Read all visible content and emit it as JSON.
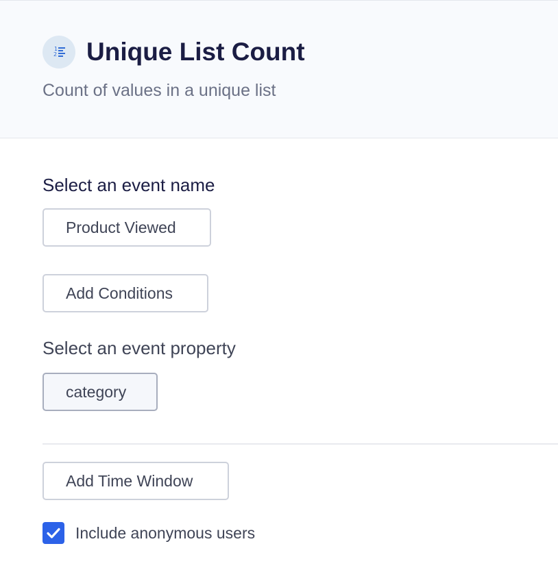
{
  "header": {
    "icon": "numbered-list-icon",
    "title": "Unique List Count",
    "subtitle": "Count of values in a unique list"
  },
  "event_section": {
    "label": "Select an event name",
    "selected_event": "Product Viewed",
    "add_conditions_label": "Add Conditions"
  },
  "property_section": {
    "label": "Select an event property",
    "selected_property": "category"
  },
  "time_window": {
    "label": "Add Time Window"
  },
  "anonymous": {
    "label": "Include anonymous users",
    "checked": true
  },
  "colors": {
    "accent": "#2c62e8",
    "title": "#1b1d44",
    "header_bg": "#f8fafd",
    "icon_bg": "#dde8f3"
  }
}
